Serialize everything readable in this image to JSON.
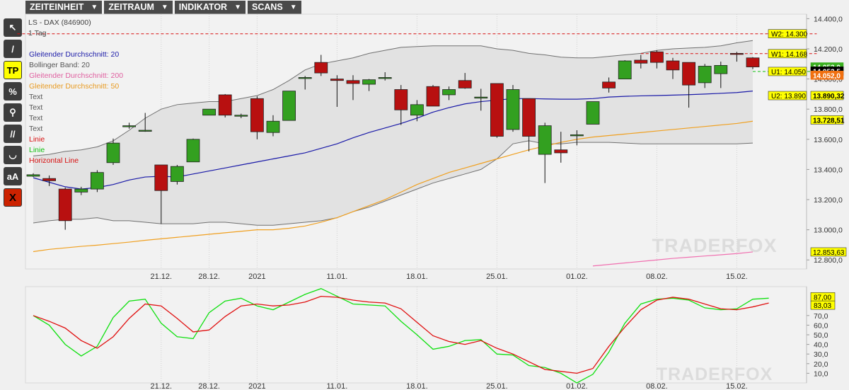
{
  "menu": [
    {
      "label": "ZEITEINHEIT",
      "name": "menu-zeiteinheit"
    },
    {
      "label": "ZEITRAUM",
      "name": "menu-zeitraum"
    },
    {
      "label": "INDIKATOR",
      "name": "menu-indikator"
    },
    {
      "label": "SCANS",
      "name": "menu-scans"
    }
  ],
  "tools": [
    {
      "name": "cursor-tool-icon",
      "glyph": "↖",
      "style": ""
    },
    {
      "name": "line-tool-icon",
      "glyph": "/",
      "style": ""
    },
    {
      "name": "tp-tool-button",
      "glyph": "TP",
      "style": "tp"
    },
    {
      "name": "percent-tool-icon",
      "glyph": "%",
      "style": ""
    },
    {
      "name": "magnifier-tool-icon",
      "glyph": "⚲",
      "style": ""
    },
    {
      "name": "parallel-lines-tool-icon",
      "glyph": "//",
      "style": ""
    },
    {
      "name": "curve-tool-icon",
      "glyph": "◡",
      "style": ""
    },
    {
      "name": "text-tool-button",
      "glyph": "aA",
      "style": ""
    },
    {
      "name": "delete-tool-button",
      "glyph": "X",
      "style": "x"
    }
  ],
  "chart_data": [
    {
      "type": "candlestick",
      "title": "LS - DAX (846900)",
      "timeframe_label": "1 Tag",
      "legend": [
        {
          "label": "Gleitender Durchschnitt: 20",
          "color": "#1a1aa8"
        },
        {
          "label": "Bollinger Band: 20",
          "color": "#555555"
        },
        {
          "label": "Gleitender Durchschnitt: 200",
          "color": "#e060a0"
        },
        {
          "label": "Gleitender Durchschnitt: 50",
          "color": "#e89a20"
        },
        {
          "label": "Text",
          "color": "#555555"
        },
        {
          "label": "Text",
          "color": "#555555"
        },
        {
          "label": "Text",
          "color": "#555555"
        },
        {
          "label": "Text",
          "color": "#555555"
        },
        {
          "label": "Linie",
          "color": "#d81010"
        },
        {
          "label": "Linie",
          "color": "#10c010"
        },
        {
          "label": "Horizontal Line",
          "color": "#d81010"
        }
      ],
      "ylim": [
        12740,
        14430
      ],
      "y_ticks": [
        12800,
        13000,
        13200,
        13400,
        13600,
        13800,
        14000,
        14200,
        14400
      ],
      "y_tick_labels": [
        "12.800,0",
        "13.000,0",
        "13.200,0",
        "13.400,0",
        "13.600,0",
        "13.800,0",
        "14.000,0",
        "14.200,0",
        "14.400,0"
      ],
      "x_labels": [
        {
          "index": 8,
          "label": "21.12."
        },
        {
          "index": 11,
          "label": "28.12."
        },
        {
          "index": 14,
          "label": "2021"
        },
        {
          "index": 19,
          "label": "11.01."
        },
        {
          "index": 24,
          "label": "18.01."
        },
        {
          "index": 29,
          "label": "25.01."
        },
        {
          "index": 34,
          "label": "01.02."
        },
        {
          "index": 39,
          "label": "08.02."
        },
        {
          "index": 44,
          "label": "15.02."
        }
      ],
      "candles": [
        {
          "o": 13355,
          "h": 13375,
          "c": 13365,
          "l": 13350
        },
        {
          "o": 13340,
          "h": 13360,
          "c": 13325,
          "l": 13290
        },
        {
          "o": 13270,
          "h": 13280,
          "c": 13060,
          "l": 13000
        },
        {
          "o": 13250,
          "h": 13285,
          "c": 13270,
          "l": 13230
        },
        {
          "o": 13270,
          "h": 13395,
          "c": 13380,
          "l": 13250
        },
        {
          "o": 13445,
          "h": 13605,
          "c": 13575,
          "l": 13430
        },
        {
          "o": 13690,
          "h": 13710,
          "c": 13690,
          "l": 13670
        },
        {
          "o": 13660,
          "h": 13775,
          "c": 13660,
          "l": 13650
        },
        {
          "o": 13430,
          "h": 13430,
          "c": 13260,
          "l": 13040
        },
        {
          "o": 13320,
          "h": 13430,
          "c": 13420,
          "l": 13300
        },
        {
          "o": 13450,
          "h": 13605,
          "c": 13600,
          "l": 13450
        },
        {
          "o": 13760,
          "h": 13790,
          "c": 13800,
          "l": 13760
        },
        {
          "o": 13895,
          "h": 13900,
          "c": 13760,
          "l": 13745
        },
        {
          "o": 13760,
          "h": 13770,
          "c": 13760,
          "l": 13740
        },
        {
          "o": 13870,
          "h": 13885,
          "c": 13650,
          "l": 13600
        },
        {
          "o": 13645,
          "h": 13760,
          "c": 13720,
          "l": 13620
        },
        {
          "o": 13725,
          "h": 13860,
          "c": 13920,
          "l": 13730
        },
        {
          "o": 14010,
          "h": 14020,
          "c": 14010,
          "l": 13930
        },
        {
          "o": 14110,
          "h": 14160,
          "c": 14040,
          "l": 14020
        },
        {
          "o": 14000,
          "h": 14025,
          "c": 13990,
          "l": 13815
        },
        {
          "o": 13990,
          "h": 14025,
          "c": 13970,
          "l": 13860
        },
        {
          "o": 13965,
          "h": 14000,
          "c": 13995,
          "l": 13920
        },
        {
          "o": 14010,
          "h": 14045,
          "c": 14010,
          "l": 13990
        },
        {
          "o": 13930,
          "h": 13960,
          "c": 13795,
          "l": 13695
        },
        {
          "o": 13760,
          "h": 13860,
          "c": 13830,
          "l": 13720
        },
        {
          "o": 13950,
          "h": 13960,
          "c": 13820,
          "l": 13820
        },
        {
          "o": 13895,
          "h": 13950,
          "c": 13930,
          "l": 13860
        },
        {
          "o": 13990,
          "h": 14040,
          "c": 13940,
          "l": 13935
        },
        {
          "o": 13880,
          "h": 13935,
          "c": 13880,
          "l": 13790
        },
        {
          "o": 13970,
          "h": 13970,
          "c": 13620,
          "l": 13610
        },
        {
          "o": 13665,
          "h": 13960,
          "c": 13930,
          "l": 13650
        },
        {
          "o": 13870,
          "h": 13870,
          "c": 13620,
          "l": 13520
        },
        {
          "o": 13500,
          "h": 13710,
          "c": 13690,
          "l": 13310
        },
        {
          "o": 13530,
          "h": 13650,
          "c": 13510,
          "l": 13445
        },
        {
          "o": 13625,
          "h": 13660,
          "c": 13630,
          "l": 13560
        },
        {
          "o": 13700,
          "h": 13845,
          "c": 13850,
          "l": 13710
        },
        {
          "o": 13980,
          "h": 14010,
          "c": 13940,
          "l": 13910
        },
        {
          "o": 14000,
          "h": 14125,
          "c": 14120,
          "l": 14000
        },
        {
          "o": 14125,
          "h": 14160,
          "c": 14105,
          "l": 14070
        },
        {
          "o": 14180,
          "h": 14190,
          "c": 14110,
          "l": 14070
        },
        {
          "o": 14120,
          "h": 14140,
          "c": 14060,
          "l": 14000
        },
        {
          "o": 14110,
          "h": 14110,
          "c": 13960,
          "l": 13810
        },
        {
          "o": 13975,
          "h": 14100,
          "c": 14085,
          "l": 13940
        },
        {
          "o": 14035,
          "h": 14115,
          "c": 14090,
          "l": 13940
        },
        {
          "o": 14170,
          "h": 14180,
          "c": 14165,
          "l": 14115
        },
        {
          "o": 14140,
          "h": 14145,
          "c": 14080,
          "l": 14065
        }
      ],
      "ma20": [
        13345,
        13315,
        13285,
        13270,
        13280,
        13300,
        13330,
        13350,
        13355,
        13350,
        13370,
        13390,
        13410,
        13430,
        13450,
        13470,
        13490,
        13510,
        13540,
        13570,
        13610,
        13645,
        13675,
        13705,
        13740,
        13780,
        13810,
        13835,
        13850,
        13860,
        13870,
        13870,
        13868,
        13866,
        13866,
        13870,
        13880,
        13885,
        13888,
        13890,
        13893,
        13896,
        13900,
        13905,
        13910,
        13920
      ],
      "ma50": [
        12855,
        12870,
        12880,
        12890,
        12898,
        12908,
        12918,
        12930,
        12940,
        12950,
        12960,
        12970,
        12980,
        12990,
        13000,
        13000,
        13010,
        13025,
        13050,
        13080,
        13120,
        13160,
        13200,
        13250,
        13300,
        13340,
        13380,
        13410,
        13440,
        13470,
        13500,
        13530,
        13555,
        13580,
        13600,
        13615,
        13625,
        13635,
        13645,
        13655,
        13665,
        13675,
        13685,
        13695,
        13705,
        13720
      ],
      "bb_upper": [
        13490,
        13500,
        13520,
        13530,
        13550,
        13590,
        13660,
        13740,
        13800,
        13830,
        13840,
        13850,
        13850,
        13870,
        13890,
        13930,
        13990,
        14060,
        14100,
        14120,
        14140,
        14170,
        14190,
        14210,
        14215,
        14220,
        14220,
        14220,
        14220,
        14200,
        14190,
        14170,
        14160,
        14145,
        14140,
        14140,
        14150,
        14160,
        14170,
        14190,
        14200,
        14205,
        14210,
        14220,
        14240,
        14255
      ],
      "bb_lower": [
        13045,
        13060,
        13070,
        13070,
        13080,
        13060,
        13060,
        13050,
        13040,
        13040,
        13040,
        13050,
        13050,
        13040,
        13030,
        13030,
        13040,
        13050,
        13060,
        13080,
        13120,
        13150,
        13190,
        13230,
        13270,
        13310,
        13340,
        13370,
        13400,
        13470,
        13570,
        13590,
        13570,
        13570,
        13580,
        13580,
        13580,
        13575,
        13570,
        13570,
        13570,
        13570,
        13570,
        13570,
        13570,
        13575
      ],
      "ma200": [
        12760,
        12770,
        12780,
        12790,
        12800,
        12810,
        12818,
        12826,
        12834,
        12842,
        12853
      ],
      "ma200_start_index": 35,
      "ma200_label": "12.853,63",
      "price_labels": [
        {
          "value": 14300,
          "label": "W2: 14.300",
          "style": "yellow"
        },
        {
          "value": 14168,
          "label": "W1: 14.168",
          "style": "yellow"
        },
        {
          "value": 14050,
          "label": "U1: 14.050",
          "style": "yellow"
        },
        {
          "value": 13890,
          "label": "U2: 13.890",
          "style": "yellow"
        }
      ],
      "right_labels": [
        {
          "value": 14080,
          "label": "14.053,0",
          "style": "green"
        },
        {
          "value": 14052.5,
          "label": "14.052,5",
          "style": "black"
        },
        {
          "value": 14025,
          "label": "14.052,0",
          "style": "orange"
        },
        {
          "value": 13890.32,
          "label": "13.890,32",
          "style": "yellow"
        },
        {
          "value": 13728.51,
          "label": "13.728,51",
          "style": "yellow"
        }
      ],
      "hlines": [
        {
          "value": 14300,
          "color": "#d81010",
          "from": -1,
          "to": 49
        },
        {
          "value": 14168,
          "color": "#d81010",
          "from": 38,
          "to": 49
        },
        {
          "value": 14050,
          "color": "#10c010",
          "from": 45,
          "to": 49
        }
      ],
      "watermark": "TRADERFOX"
    },
    {
      "type": "line",
      "title": "",
      "ylim": [
        0,
        100
      ],
      "y_ticks": [
        10,
        20,
        30,
        40,
        50,
        60,
        70
      ],
      "y_tick_labels": [
        "10,0",
        "20,0",
        "30,0",
        "40,0",
        "50,0",
        "60,0",
        "70,0"
      ],
      "series": [
        {
          "name": "",
          "color": "#10e010",
          "last_label": "87,00",
          "values": [
            70,
            60,
            40,
            28,
            38,
            68,
            85,
            87,
            62,
            48,
            46,
            73,
            85,
            88,
            80,
            76,
            84,
            92,
            98,
            90,
            82,
            81,
            80,
            64,
            50,
            35,
            38,
            44,
            45,
            30,
            29,
            18,
            16,
            10,
            0,
            9,
            32,
            62,
            82,
            87,
            88,
            86,
            78,
            76,
            77,
            87,
            88
          ]
        },
        {
          "name": "",
          "color": "#e01010",
          "last_label": "83,03",
          "values": [
            70,
            64,
            57,
            44,
            36,
            48,
            67,
            82,
            80,
            67,
            53,
            55,
            69,
            80,
            82,
            80,
            81,
            84,
            90,
            89,
            86,
            84,
            83,
            77,
            63,
            49,
            43,
            40,
            44,
            36,
            30,
            22,
            14,
            12,
            10,
            15,
            38,
            58,
            76,
            86,
            89,
            87,
            82,
            77,
            76,
            79,
            83
          ]
        }
      ],
      "watermark": "TRADERFOX"
    }
  ]
}
